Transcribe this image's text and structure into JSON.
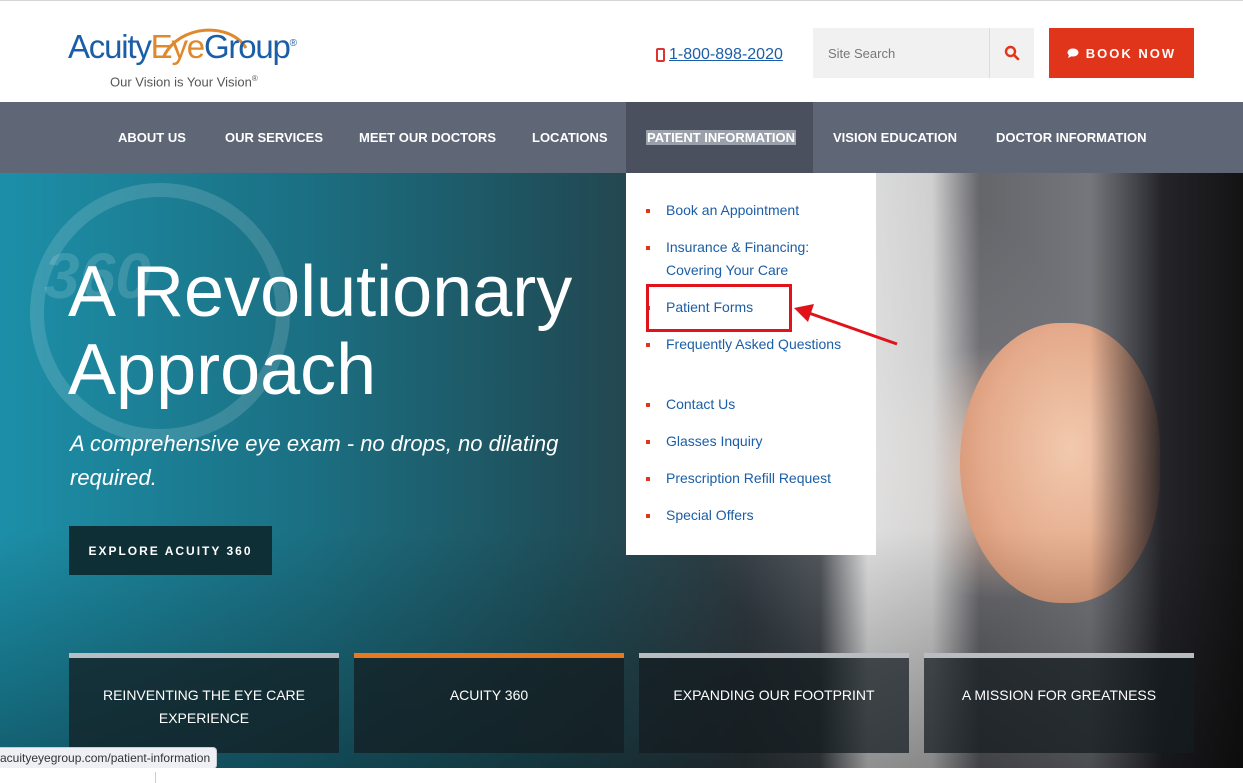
{
  "header": {
    "logo": {
      "part1": "Acuity",
      "part2": "Eye",
      "part3": "Group",
      "reg": "®",
      "tagline": "Our Vision is Your Vision",
      "tag_reg": "®"
    },
    "phone": "1-800-898-2020",
    "search": {
      "placeholder": "Site Search"
    },
    "book_label": "BOOK NOW"
  },
  "nav": {
    "items": [
      {
        "label": "ABOUT US"
      },
      {
        "label": "OUR SERVICES"
      },
      {
        "label": "MEET OUR DOCTORS"
      },
      {
        "label": "LOCATIONS"
      },
      {
        "label": "PATIENT INFORMATION"
      },
      {
        "label": "VISION EDUCATION"
      },
      {
        "label": "DOCTOR INFORMATION"
      }
    ]
  },
  "dropdown": {
    "items": [
      {
        "label": "Book an Appointment"
      },
      {
        "label": "Insurance & Financing: Covering Your Care"
      },
      {
        "label": "Patient Forms"
      },
      {
        "label": "Frequently Asked Questions"
      },
      {
        "label": "Contact Us"
      },
      {
        "label": "Glasses Inquiry"
      },
      {
        "label": "Prescription Refill Request"
      },
      {
        "label": "Special Offers"
      }
    ]
  },
  "hero": {
    "badge": "360",
    "title_line1": "A Revolutionary",
    "title_line2": "Approach",
    "subtitle": "A comprehensive eye exam - no drops, no dilating required.",
    "explore_label": "EXPLORE ACUITY 360",
    "cards": [
      {
        "label": "REINVENTING THE EYE CARE EXPERIENCE"
      },
      {
        "label": "ACUITY 360"
      },
      {
        "label": "EXPANDING OUR FOOTPRINT"
      },
      {
        "label": "A MISSION FOR GREATNESS"
      }
    ]
  },
  "status_url": "acuityeyegroup.com/patient-information",
  "colors": {
    "brand_blue": "#1b5ea7",
    "accent_orange": "#e8791e",
    "book_red": "#e0351b",
    "nav_gray": "#5f6776"
  }
}
